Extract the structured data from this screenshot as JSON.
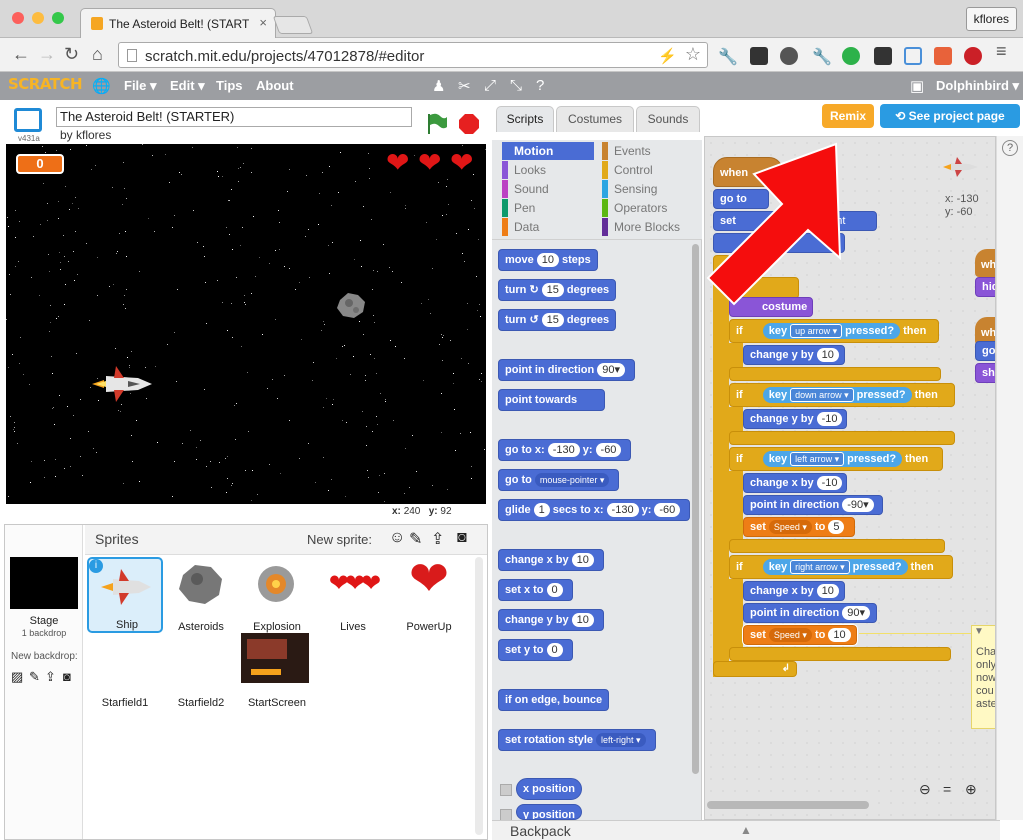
{
  "browser": {
    "tab_title": "The Asteroid Belt! (STARTE",
    "user": "kflores",
    "url": "scratch.mit.edu/projects/47012878/#editor",
    "colors": {
      "close": "#fc605c",
      "min": "#fdbc40",
      "max": "#34c84a"
    }
  },
  "menubar": {
    "logo": "SCRATCH",
    "items": [
      "File ▾",
      "Edit ▾",
      "Tips",
      "About"
    ],
    "user": "Dolphinbird ▾"
  },
  "stage": {
    "version": "v431a",
    "project_title": "The Asteroid Belt! (STARTER)",
    "author": "by kflores",
    "score": "0",
    "hearts": [
      "❤",
      "❤",
      "❤"
    ],
    "x_label": "x:",
    "x_val": "240",
    "y_label": "y:",
    "y_val": "92"
  },
  "sprites": {
    "title": "Sprites",
    "new_sprite_label": "New sprite:",
    "stage_label": "Stage",
    "backdrop_count": "1 backdrop",
    "new_backdrop_label": "New backdrop:",
    "items": [
      "Ship",
      "Asteroids",
      "Explosion",
      "Lives",
      "PowerUp",
      "Starfield1",
      "Starfield2",
      "StartScreen"
    ]
  },
  "tabs": {
    "scripts": "Scripts",
    "costumes": "Costumes",
    "sounds": "Sounds"
  },
  "categories": {
    "motion": "Motion",
    "looks": "Looks",
    "sound": "Sound",
    "pen": "Pen",
    "data": "Data",
    "events": "Events",
    "control": "Control",
    "sensing": "Sensing",
    "operators": "Operators",
    "more": "More Blocks"
  },
  "palette": {
    "move": "move",
    "move_n": "10",
    "move_s": "steps",
    "turn_r": "turn ↻",
    "turn_r_n": "15",
    "deg": "degrees",
    "turn_l": "turn ↺",
    "turn_l_n": "15",
    "point_dir": "point in direction",
    "point_dir_n": "90▾",
    "point_towards": "point towards",
    "goto_xy": "go to x:",
    "goto_x": "-130",
    "y": "y:",
    "goto_y": "-60",
    "goto": "go to",
    "goto_target": "mouse-pointer ▾",
    "glide": "glide",
    "glide_n": "1",
    "glide_s": "secs to x:",
    "glide_x": "-130",
    "glide_y": "-60",
    "change_x": "change x by",
    "change_x_n": "10",
    "set_x": "set x to",
    "set_x_n": "0",
    "change_y": "change y by",
    "change_y_n": "10",
    "set_y": "set y to",
    "set_y_n": "0",
    "bounce": "if on edge, bounce",
    "rot_style": "set rotation style",
    "rot_val": "left-right ▾",
    "xpos": "x position",
    "ypos": "y position"
  },
  "backpack": "Backpack",
  "buttons": {
    "remix": "Remix",
    "see_page": "See project page"
  },
  "script": {
    "when": "when",
    "goto": "go to",
    "set": "set",
    "right": "right",
    "costume": "costume",
    "if": "if",
    "key": "key",
    "pressed": "pressed?",
    "then": "then",
    "up": "up arrow ▾",
    "down": "down arrow ▾",
    "left": "left arrow ▾",
    "rightk": "right arrow ▾",
    "change_y": "change y by",
    "n10": "10",
    "nm10": "-10",
    "change_x": "change x by",
    "point_dir": "point in direction",
    "dir_m90": "-90▾",
    "dir_90": "90▾",
    "set_kw": "set",
    "speed": "Speed ▾",
    "to": "to",
    "n5": "5",
    "n10b": "10",
    "sprite_x": "x: -130",
    "sprite_y": "y: -60",
    "right_when": "wh",
    "right_hide": "hid",
    "right_go": "go",
    "right_show": "sho",
    "comment": [
      "Cha",
      "only",
      "now",
      "cou",
      "aste"
    ]
  }
}
